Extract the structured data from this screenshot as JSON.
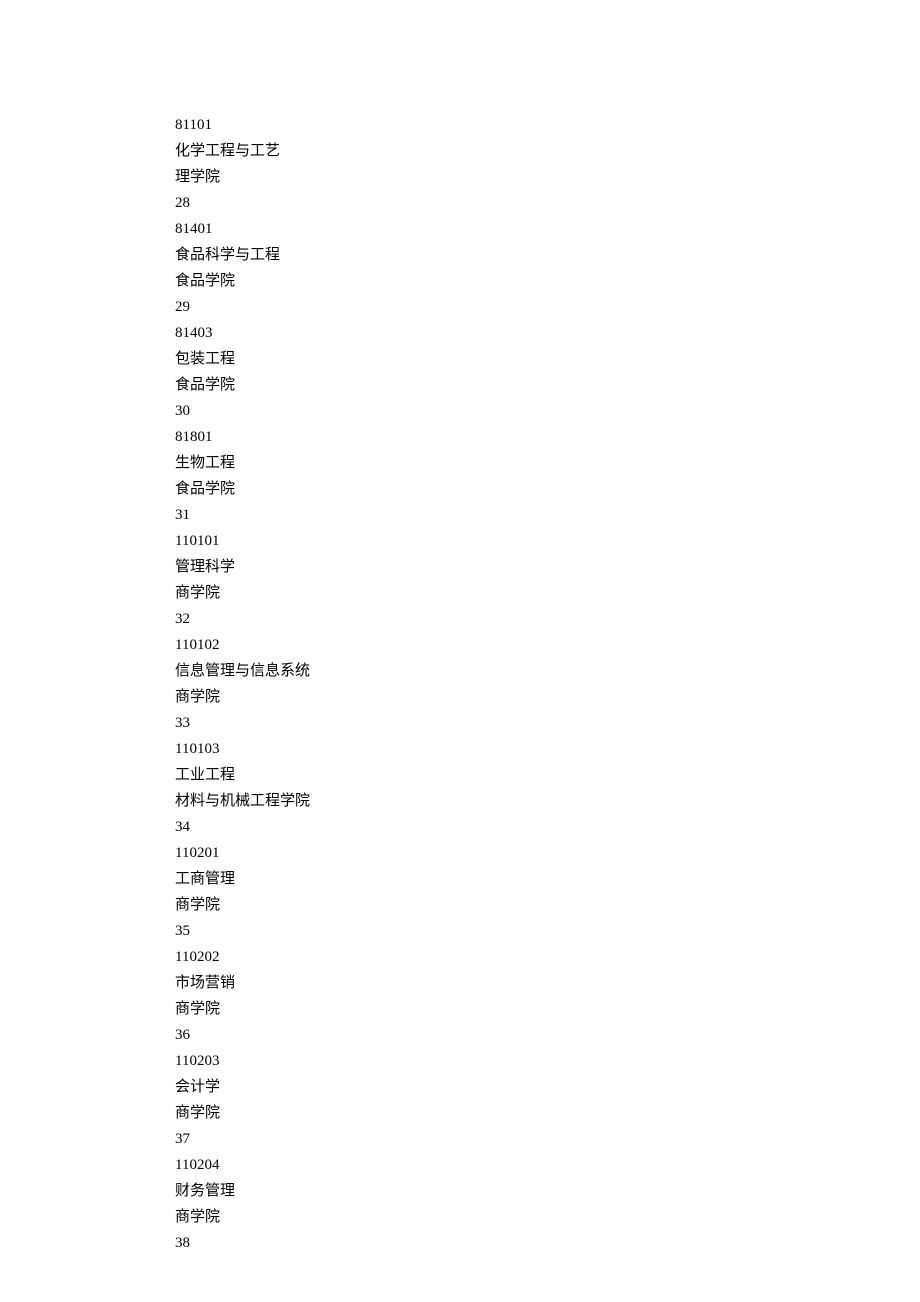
{
  "lines": [
    "81101",
    "化学工程与工艺",
    "理学院",
    "28",
    "81401",
    "食品科学与工程",
    "食品学院",
    "29",
    "81403",
    "包装工程",
    "食品学院",
    "30",
    "81801",
    "生物工程",
    "食品学院",
    "31",
    "110101",
    "管理科学",
    "商学院",
    "32",
    "110102",
    "信息管理与信息系统",
    "商学院",
    "33",
    "110103",
    "工业工程",
    "材料与机械工程学院",
    "34",
    "110201",
    "工商管理",
    "商学院",
    "35",
    "110202",
    "市场营销",
    "商学院",
    "36",
    "110203",
    "会计学",
    "商学院",
    "37",
    "110204",
    "财务管理",
    "商学院",
    "38"
  ]
}
